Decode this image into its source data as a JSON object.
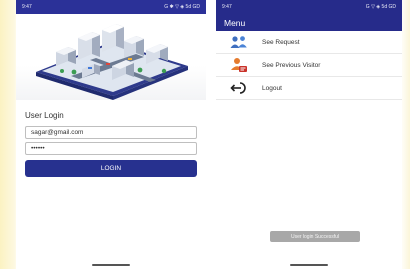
{
  "left_screen": {
    "status_time": "9:47",
    "status_icons": "G ✱ ▽ ◈ 5d GD",
    "login_title": "User Login",
    "email_value": "sagar@gmail.com",
    "password_value": "••••••",
    "login_button": "LOGIN"
  },
  "right_screen": {
    "status_time": "9:47",
    "status_icons": "G ▽ ◈ 5d GD",
    "menu_title": "Menu",
    "menu_items": [
      {
        "label": "See Request",
        "icon": "people-icon"
      },
      {
        "label": "See Previous Visitor",
        "icon": "visitor-icon"
      },
      {
        "label": "Logout",
        "icon": "logout-icon"
      }
    ],
    "toast": "User login Successful"
  },
  "colors": {
    "primary": "#27318f",
    "status_bar": "#2b3198",
    "toast": "#a8a8a8"
  }
}
